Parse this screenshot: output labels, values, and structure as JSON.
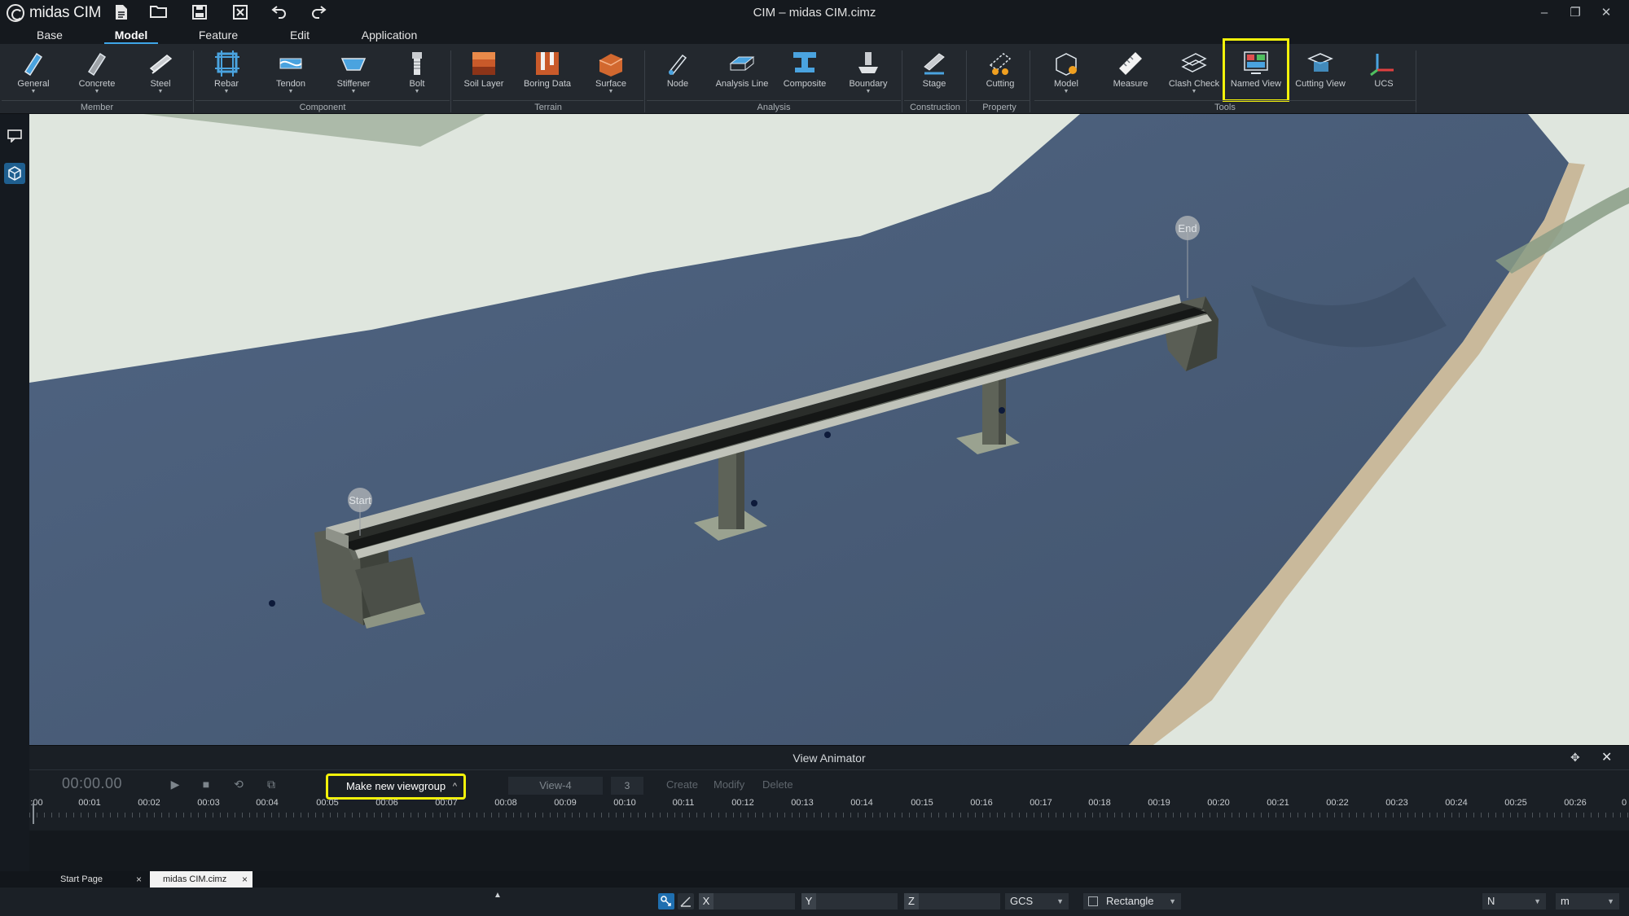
{
  "app": {
    "logo_text": "midas CIM",
    "window_title": "CIM – midas CIM.cimz"
  },
  "menu": {
    "tabs": [
      "Base",
      "Model",
      "Feature",
      "Edit",
      "Application"
    ],
    "active": "Model"
  },
  "ribbon": {
    "tools": [
      "General",
      "Concrete",
      "Steel",
      "Rebar",
      "Tendon",
      "Stiffener",
      "Bolt",
      "Soil Layer",
      "Boring Data",
      "Surface",
      "Node",
      "Analysis Line",
      "Composite",
      "Boundary",
      "Stage",
      "Cutting",
      "Model",
      "Measure",
      "Clash Check",
      "Named View",
      "Cutting View",
      "UCS"
    ],
    "groups": [
      "Member",
      "Component",
      "Terrain",
      "Analysis",
      "Construction",
      "Property",
      "Tools"
    ],
    "highlighted_tool": "Named View"
  },
  "viewport": {
    "start_label": "Start",
    "end_label": "End"
  },
  "animator": {
    "title": "View Animator",
    "time": "00:00.00",
    "viewgroup_button": "Make new viewgroup",
    "view_name": "View-4",
    "view_count": "3",
    "actions": [
      "Create",
      "Modify",
      "Delete"
    ],
    "timeline_ticks": [
      ":00",
      "00:01",
      "00:02",
      "00:03",
      "00:04",
      "00:05",
      "00:06",
      "00:07",
      "00:08",
      "00:09",
      "00:10",
      "00:11",
      "00:12",
      "00:13",
      "00:14",
      "00:15",
      "00:16",
      "00:17",
      "00:18",
      "00:19",
      "00:20",
      "00:21",
      "00:22",
      "00:23",
      "00:24",
      "00:25",
      "00:26",
      "0"
    ]
  },
  "doc_tabs": [
    {
      "label": "Start Page",
      "active": false
    },
    {
      "label": "midas CIM.cimz",
      "active": true
    }
  ],
  "statusbar": {
    "x_label": "X",
    "y_label": "Y",
    "z_label": "Z",
    "coord_system": "GCS",
    "selection_mode": "Rectangle",
    "direction": "N",
    "unit": "m"
  },
  "colors": {
    "highlight": "#f3f20a",
    "accent": "#3ea6e8",
    "water": "#475a74",
    "land": "#dde4dc"
  }
}
